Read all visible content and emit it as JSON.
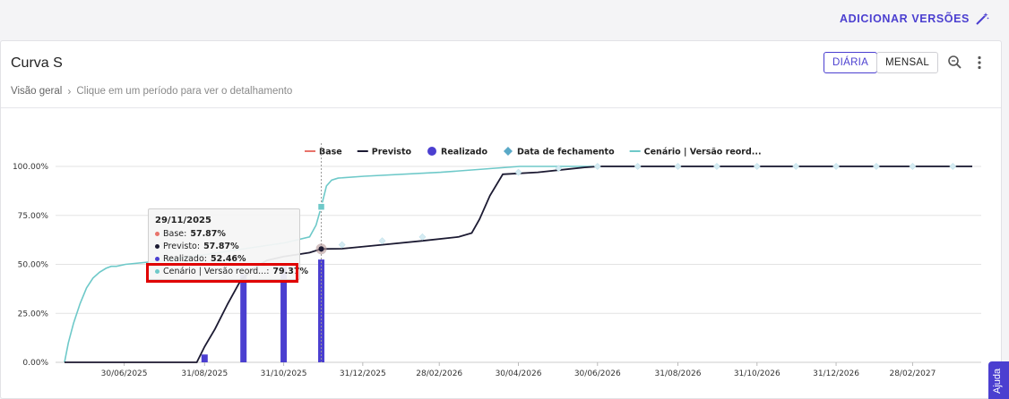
{
  "header": {
    "add_versions_label": "ADICIONAR VERSÕES",
    "add_versions_icon": "magic-wand-icon"
  },
  "card": {
    "title": "Curva S",
    "breadcrumb": {
      "root": "Visão geral",
      "hint": "Clique em um período para ver o detalhamento"
    },
    "buttons": {
      "daily": "DIÁRIA",
      "monthly": "MENSAL"
    },
    "icons": {
      "zoom": "zoom-icon",
      "more": "more-vertical-icon"
    }
  },
  "help_tab": {
    "label": "Ajuda"
  },
  "colors": {
    "accent": "#4b3fd0",
    "base": "#e8736b",
    "previsto": "#1c1b33",
    "realizado": "#4b3fd0",
    "fechamento": "#5aa9c7",
    "cenario": "#6ec9c9",
    "highlight": "#e00000"
  },
  "chart_data": {
    "type": "line",
    "legend": [
      {
        "name": "Base",
        "marker": "line",
        "color": "#e8736b"
      },
      {
        "name": "Previsto",
        "marker": "line",
        "color": "#1c1b33"
      },
      {
        "name": "Realizado",
        "marker": "circle",
        "color": "#4b3fd0"
      },
      {
        "name": "Data de fechamento",
        "marker": "diamond",
        "color": "#5aa9c7"
      },
      {
        "name": "Cenário | Versão reord...",
        "marker": "line",
        "color": "#6ec9c9"
      }
    ],
    "legend_position": "top-center",
    "y_ticks": [
      "0.00%",
      "25.00%",
      "50.00%",
      "75.00%",
      "100.00%"
    ],
    "ylim": [
      0,
      100
    ],
    "x_ticks": [
      "30/06/2025",
      "31/08/2025",
      "31/10/2025",
      "31/12/2025",
      "28/02/2026",
      "30/04/2026",
      "30/06/2026",
      "31/08/2026",
      "31/10/2026",
      "31/12/2026",
      "28/02/2027"
    ],
    "x_tick_dates": [
      "2025-06-30",
      "2025-08-31",
      "2025-10-31",
      "2025-12-31",
      "2026-02-28",
      "2026-04-30",
      "2026-06-30",
      "2026-08-31",
      "2026-10-31",
      "2026-12-31",
      "2027-02-28"
    ],
    "xlim": [
      "2025-05-15",
      "2027-04-15"
    ],
    "grid": true,
    "series": [
      {
        "name": "Cenário | Versão reord...",
        "x": [
          "2025-05-15",
          "2025-05-18",
          "2025-05-22",
          "2025-05-27",
          "2025-06-01",
          "2025-06-06",
          "2025-06-11",
          "2025-06-16",
          "2025-06-20",
          "2025-06-24",
          "2025-07-01",
          "2025-08-01",
          "2025-09-01",
          "2025-10-01",
          "2025-11-01",
          "2025-11-20",
          "2025-11-25",
          "2025-11-29",
          "2025-12-03",
          "2025-12-07",
          "2025-12-12",
          "2026-01-01",
          "2026-03-01",
          "2026-05-01",
          "2026-07-01",
          "2027-04-15"
        ],
        "values": [
          0,
          10,
          20,
          30,
          38,
          43,
          46,
          48,
          49,
          49,
          50,
          52,
          55,
          58,
          61,
          64,
          70,
          79.37,
          90,
          93,
          94,
          95,
          97,
          100,
          100,
          100
        ]
      },
      {
        "name": "Previsto",
        "x": [
          "2025-05-15",
          "2025-08-25",
          "2025-08-31",
          "2025-09-08",
          "2025-09-18",
          "2025-09-28",
          "2025-10-08",
          "2025-10-18",
          "2025-10-31",
          "2025-11-10",
          "2025-11-20",
          "2025-11-29",
          "2025-12-15",
          "2026-01-15",
          "2026-02-15",
          "2026-03-15",
          "2026-03-25",
          "2026-03-31",
          "2026-04-08",
          "2026-04-18",
          "2026-05-15",
          "2026-06-20",
          "2026-07-01",
          "2027-04-15"
        ],
        "values": [
          0,
          0,
          8,
          17,
          30,
          42,
          48,
          52,
          54,
          55,
          56,
          57.87,
          58,
          60,
          62,
          64,
          66,
          73,
          85,
          96,
          97,
          99.5,
          100,
          100
        ]
      },
      {
        "name": "Base",
        "x": [
          "2025-05-15",
          "2025-08-25",
          "2025-08-31",
          "2025-09-08",
          "2025-09-18",
          "2025-09-28",
          "2025-10-08",
          "2025-10-18",
          "2025-10-31",
          "2025-11-10",
          "2025-11-20",
          "2025-11-29",
          "2025-12-15",
          "2026-01-15",
          "2026-02-15",
          "2026-03-15",
          "2026-03-25",
          "2026-03-31",
          "2026-04-08",
          "2026-04-18",
          "2026-05-15",
          "2026-06-20",
          "2026-07-01",
          "2027-04-15"
        ],
        "values": [
          0,
          0,
          8,
          17,
          30,
          42,
          48,
          52,
          54,
          55,
          56,
          57.87,
          58,
          60,
          62,
          64,
          66,
          73,
          85,
          96,
          97,
          99.5,
          100,
          100
        ]
      },
      {
        "name": "Realizado",
        "type": "bar",
        "x": [
          "2025-08-31",
          "2025-09-30",
          "2025-10-31",
          "2025-11-29"
        ],
        "values": [
          4,
          45,
          50,
          52.46
        ]
      },
      {
        "name": "Data de fechamento",
        "type": "scatter",
        "x": [
          "2025-12-15",
          "2026-01-15",
          "2026-02-15",
          "2026-04-30",
          "2026-05-31",
          "2026-06-30",
          "2026-07-31",
          "2026-08-31",
          "2026-09-30",
          "2026-10-31",
          "2026-11-30",
          "2026-12-31",
          "2027-01-31",
          "2027-02-28",
          "2027-03-31"
        ],
        "values": [
          60,
          62,
          64,
          97,
          99,
          100,
          100,
          100,
          100,
          100,
          100,
          100,
          100,
          100,
          100
        ]
      }
    ],
    "tooltip": {
      "date": "29/11/2025",
      "rows": [
        {
          "label": "Base:",
          "value": "57.87%",
          "color": "#e8736b"
        },
        {
          "label": "Previsto:",
          "value": "57.87%",
          "color": "#1c1b33"
        },
        {
          "label": "Realizado:",
          "value": "52.46%",
          "color": "#4b3fd0"
        },
        {
          "label": "Cenário | Versão reord...:",
          "value": "79.37%",
          "color": "#6ec9c9"
        }
      ],
      "crosshair_date": "2025-11-29"
    }
  }
}
